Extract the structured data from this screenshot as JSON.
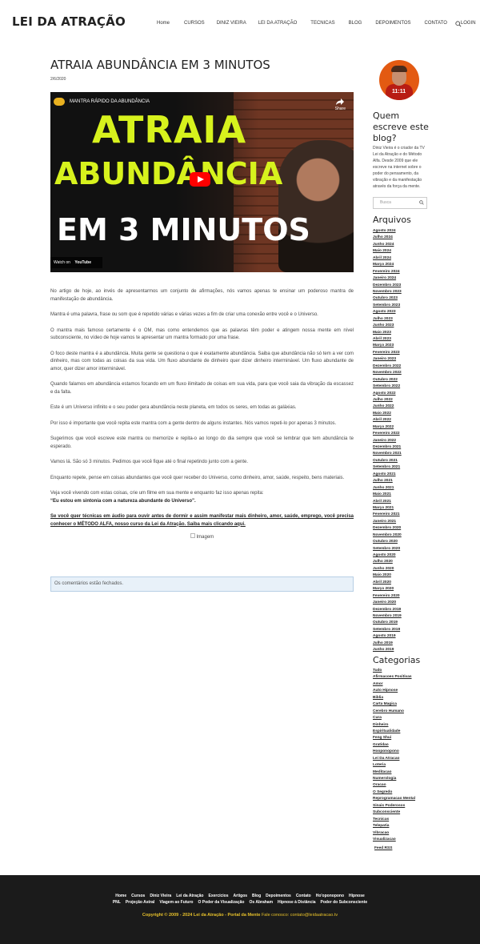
{
  "header": {
    "logo": "LEI DA ATRAÇÃO",
    "nav": [
      "Home",
      "CURSOS",
      "DINIZ VIEIRA",
      "LEI DA ATRAÇÃO",
      "TECNICAS",
      "BLOG",
      "DEPOIMENTOS",
      "CONTATO",
      "LOGIN"
    ]
  },
  "post": {
    "title": "ATRAIA ABUNDÂNCIA EM 3 MINUTOS",
    "date": "2/6/2020",
    "video": {
      "channel_title": "MANTRA RÁPIDO DA ABUNDÂNCIA",
      "share": "Share",
      "line1": "ATRAIA",
      "line2": "ABUNDÂNCIA",
      "line3": "EM 3 MINUTOS",
      "watch_on": "Watch on",
      "platform": "YouTube"
    },
    "paragraphs": [
      "No artigo de hoje, ao invés de apresentarmos um conjunto de afirmações, nós vamos apenas te ensinar um poderoso mantra de manifestação de abundância.",
      "Mantra é uma palavra, frase ou som que é repetido várias e várias vezes a fim de criar uma conexão entre você e o Universo.",
      "O mantra mais famoso certamente é o OM, mas como entendemos que as palavras têm poder e atingem nossa mente em nível subconsciente, no vídeo de hoje vamos te apresentar um mantra formado por uma frase.",
      "O foco deste mantra é a abundância. Muita gente se questiona o que é exatamente abundância. Saiba que abundância não só tem a ver com dinheiro, mas com todas as coisas da sua vida. Um fluxo abundante de dinheiro quer dizer dinheiro interminável. Um fluxo abundante de amor, quer dizer amor interminável.",
      "Quando falamos em abundância estamos focando em um fluxo ilimitado de coisas em sua vida, para que você saia da vibração da escassez e da falta.",
      "Este é um Universo infinito e o seu poder gera abundância neste planeta, em todos os seres, em todas as galáxias.",
      "Por isso é importante que você repita este mantra com a gente dentro de alguns instantes. Nós vamos repeti-lo por apenas 3 minutos.",
      "Sugerimos que você escreve este mantra ou memorize e repita-o ao longo do dia sempre que você se lembrar que tem abundância te esperado.",
      "Vamos lá. São só 3 minutos. Pedimos que você fique até o final repetindo junto com a gente.",
      "Enquanto repete, pense em coisas abundantes que você quer receber do Universo, como dinheiro, amor, saúde, respeito, bens materiais.",
      "Veja você vivendo com estas coisas, crie um filme em sua mente e enquanto faz isso apenas repita:"
    ],
    "mantra": "“Eu estou em sintonia com a natureza abundante do Universo”.",
    "cta_link": "Se você quer técnicas em áudio para ouvir antes de dormir e assim manifestar mais dinheiro, amor, saúde, emprego, você precisa conhecer o MÉTODO ALFA, nosso curso da Lei da Atração. Saiba mais clicando aqui.",
    "image_alt": "Imagem",
    "comments_closed": "Os comentários estão fechados."
  },
  "sidebar": {
    "about_heading": "Quem escreve este blog?",
    "about_text": "Diniz Vieira é o criador da TV Lei da Atração e do Método Alfa. Desde 2009 que ele escreve na internet sobre o poder do pensamento, da vibração e da manifestação através da força da mente.",
    "avatar_badge": "11:11",
    "search_placeholder": "Busca",
    "archives_heading": "Arquivos",
    "archives": [
      "Agosto 2024",
      "Julho 2024",
      "Junho 2024",
      "Maio 2024",
      "Abril 2024",
      "Março 2024",
      "Fevereiro 2024",
      "Janeiro 2024",
      "Dezembro 2023",
      "Novembro 2023",
      "Outubro 2023",
      "Setembro 2023",
      "Agosto 2023",
      "Julho 2023",
      "Junho 2023",
      "Maio 2023",
      "Abril 2023",
      "Março 2023",
      "Fevereiro 2023",
      "Janeiro 2023",
      "Dezembro 2022",
      "Novembro 2022",
      "Outubro 2022",
      "Setembro 2022",
      "Agosto 2022",
      "Julho 2022",
      "Junho 2022",
      "Maio 2022",
      "Abril 2022",
      "Março 2022",
      "Fevereiro 2022",
      "Janeiro 2022",
      "Dezembro 2021",
      "Novembro 2021",
      "Outubro 2021",
      "Setembro 2021",
      "Agosto 2021",
      "Julho 2021",
      "Junho 2021",
      "Maio 2021",
      "Abril 2021",
      "Março 2021",
      "Fevereiro 2021",
      "Janeiro 2021",
      "Dezembro 2020",
      "Novembro 2020",
      "Outubro 2020",
      "Setembro 2020",
      "Agosto 2020",
      "Julho 2020",
      "Junho 2020",
      "Maio 2020",
      "Abril 2020",
      "Março 2020",
      "Fevereiro 2020",
      "Janeiro 2020",
      "Dezembro 2019",
      "Novembro 2019",
      "Outubro 2019",
      "Setembro 2019",
      "Agosto 2019",
      "Julho 2019",
      "Junho 2019"
    ],
    "categories_heading": "Categorias",
    "categories": [
      "Tudo",
      "Afirmacoes Positivas",
      "Amor",
      "Auto Hipnose",
      "Biblia",
      "Carta Magica",
      "Cerebro Humano",
      "Cura",
      "Dinheiro",
      "Espiritualidade",
      "Feng Shui",
      "Gratidao",
      "Hooponopono",
      "Lei Da Atracao",
      "Loteria",
      "Meditacao",
      "Numerologia",
      "Oracao",
      "O Segredo",
      "Reprogramacao Mental",
      "Sinais Poderosos",
      "Subconsciente",
      "Tecnicas",
      "Telepatia",
      "Vibracao",
      "Visualizacao"
    ],
    "feed": "Feed RSS"
  },
  "footer": {
    "row1": [
      "Home",
      "Cursos",
      "Diniz Vieira",
      "Lei da Atração",
      "Exercícios",
      "Artigos",
      "Blog",
      "Depoimentos",
      "Contato",
      "Ho'oponopono",
      "Hipnose"
    ],
    "row2": [
      "PNL",
      "Projeção Astral",
      "Viagem ao Futuro",
      "O Poder da Visualização",
      "Os Abraham",
      "Hipnose à Distância",
      "Poder do Subconsciente"
    ],
    "copyright": "Copyright © 2009 - 2024 Lei da Atração - Portal da Mente",
    "contact": "Fale conosco: contato@leidaatracao.tv"
  }
}
